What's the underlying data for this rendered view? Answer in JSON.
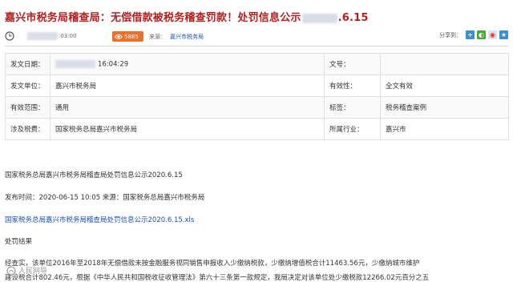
{
  "title": {
    "prefix": "嘉兴市税务局稽查局：无偿借款被税务稽查罚款！处罚信息公示",
    "suffix": ".6.15"
  },
  "meta": {
    "time": ":03:00",
    "views": "5885",
    "source_label": "来源：",
    "source": "嘉兴市税务局",
    "share_label": "分享到："
  },
  "info_table": {
    "rows": [
      {
        "label1": "发文日期：",
        "value1": "16:04:29",
        "label2": "文号：",
        "value2": ""
      },
      {
        "label1": "发文单位：",
        "value1": "嘉兴市税务局",
        "label2": "有效性：",
        "value2": "全文有效"
      },
      {
        "label1": "有效范围：",
        "value1": "通用",
        "label2": "标签：",
        "value2": "税务稽查案例"
      },
      {
        "label1": "涉及税费：",
        "value1": "国家税务总局嘉兴市税务局",
        "label2": "所属行业：",
        "value2": "嘉兴市"
      }
    ]
  },
  "content": {
    "heading": "国家税务总局嘉兴市税务局稽查局处罚信息公示2020.6.15",
    "publish_line": "发布时间：2020-06-15  10:05 来源：国家税务总局嘉兴市税务局",
    "attachment": "国家税务总局嘉兴市税务局稽查局处罚信息公示2020.6.15.xls",
    "section_title": "处罚结果",
    "para1": "经查实，该单位2016年至2018年无偿借款未按金融服务视同销售申报收入少缴纳税款，少缴纳增值税合计11463.56元，少缴纳城市维护",
    "para2": "建设税合计802.46元，根据《中华人民共和国税收征收管理法》第六十三条第一款规定，我局决定对该单位处少缴税款12266.02元百分之五"
  },
  "watermark": {
    "text": "人民网导"
  },
  "colors": {
    "title": "#b41e1e",
    "link": "#1a4fb4",
    "badge": "#e8722c"
  }
}
